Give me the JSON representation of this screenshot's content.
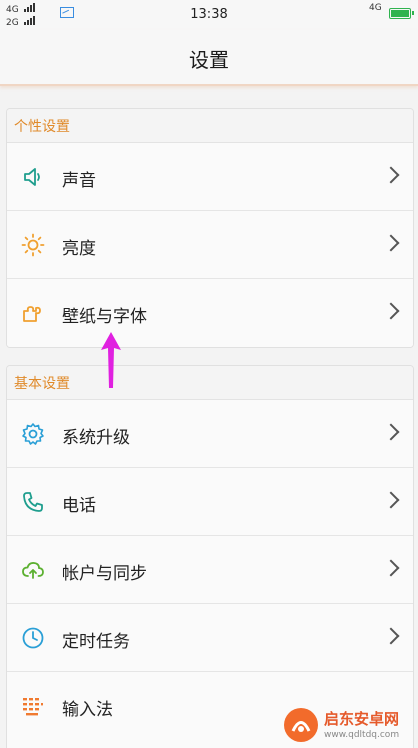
{
  "status_bar": {
    "net_top": "4G",
    "net_bottom": "2G",
    "time": "13:38",
    "net_right": "4G",
    "battery_level": 1.0
  },
  "header": {
    "title": "设置"
  },
  "sections": [
    {
      "title": "个性设置",
      "items": [
        {
          "label": "声音",
          "icon": "speaker-icon"
        },
        {
          "label": "亮度",
          "icon": "sun-icon"
        },
        {
          "label": "壁纸与字体",
          "icon": "puzzle-icon"
        }
      ]
    },
    {
      "title": "基本设置",
      "items": [
        {
          "label": "系统升级",
          "icon": "gear-icon"
        },
        {
          "label": "电话",
          "icon": "phone-icon"
        },
        {
          "label": "帐户与同步",
          "icon": "cloud-sync-icon"
        },
        {
          "label": "定时任务",
          "icon": "clock-icon"
        },
        {
          "label": "输入法",
          "icon": "keyboard-icon"
        }
      ]
    }
  ],
  "watermark": {
    "title": "启东安卓网",
    "url": "www.qdltdq.com"
  },
  "colors": {
    "accent": "#e08a2a",
    "teal": "#1f9e8e",
    "orange": "#f0a030",
    "annotation": "#e020e0",
    "battery": "#2fb34f"
  }
}
